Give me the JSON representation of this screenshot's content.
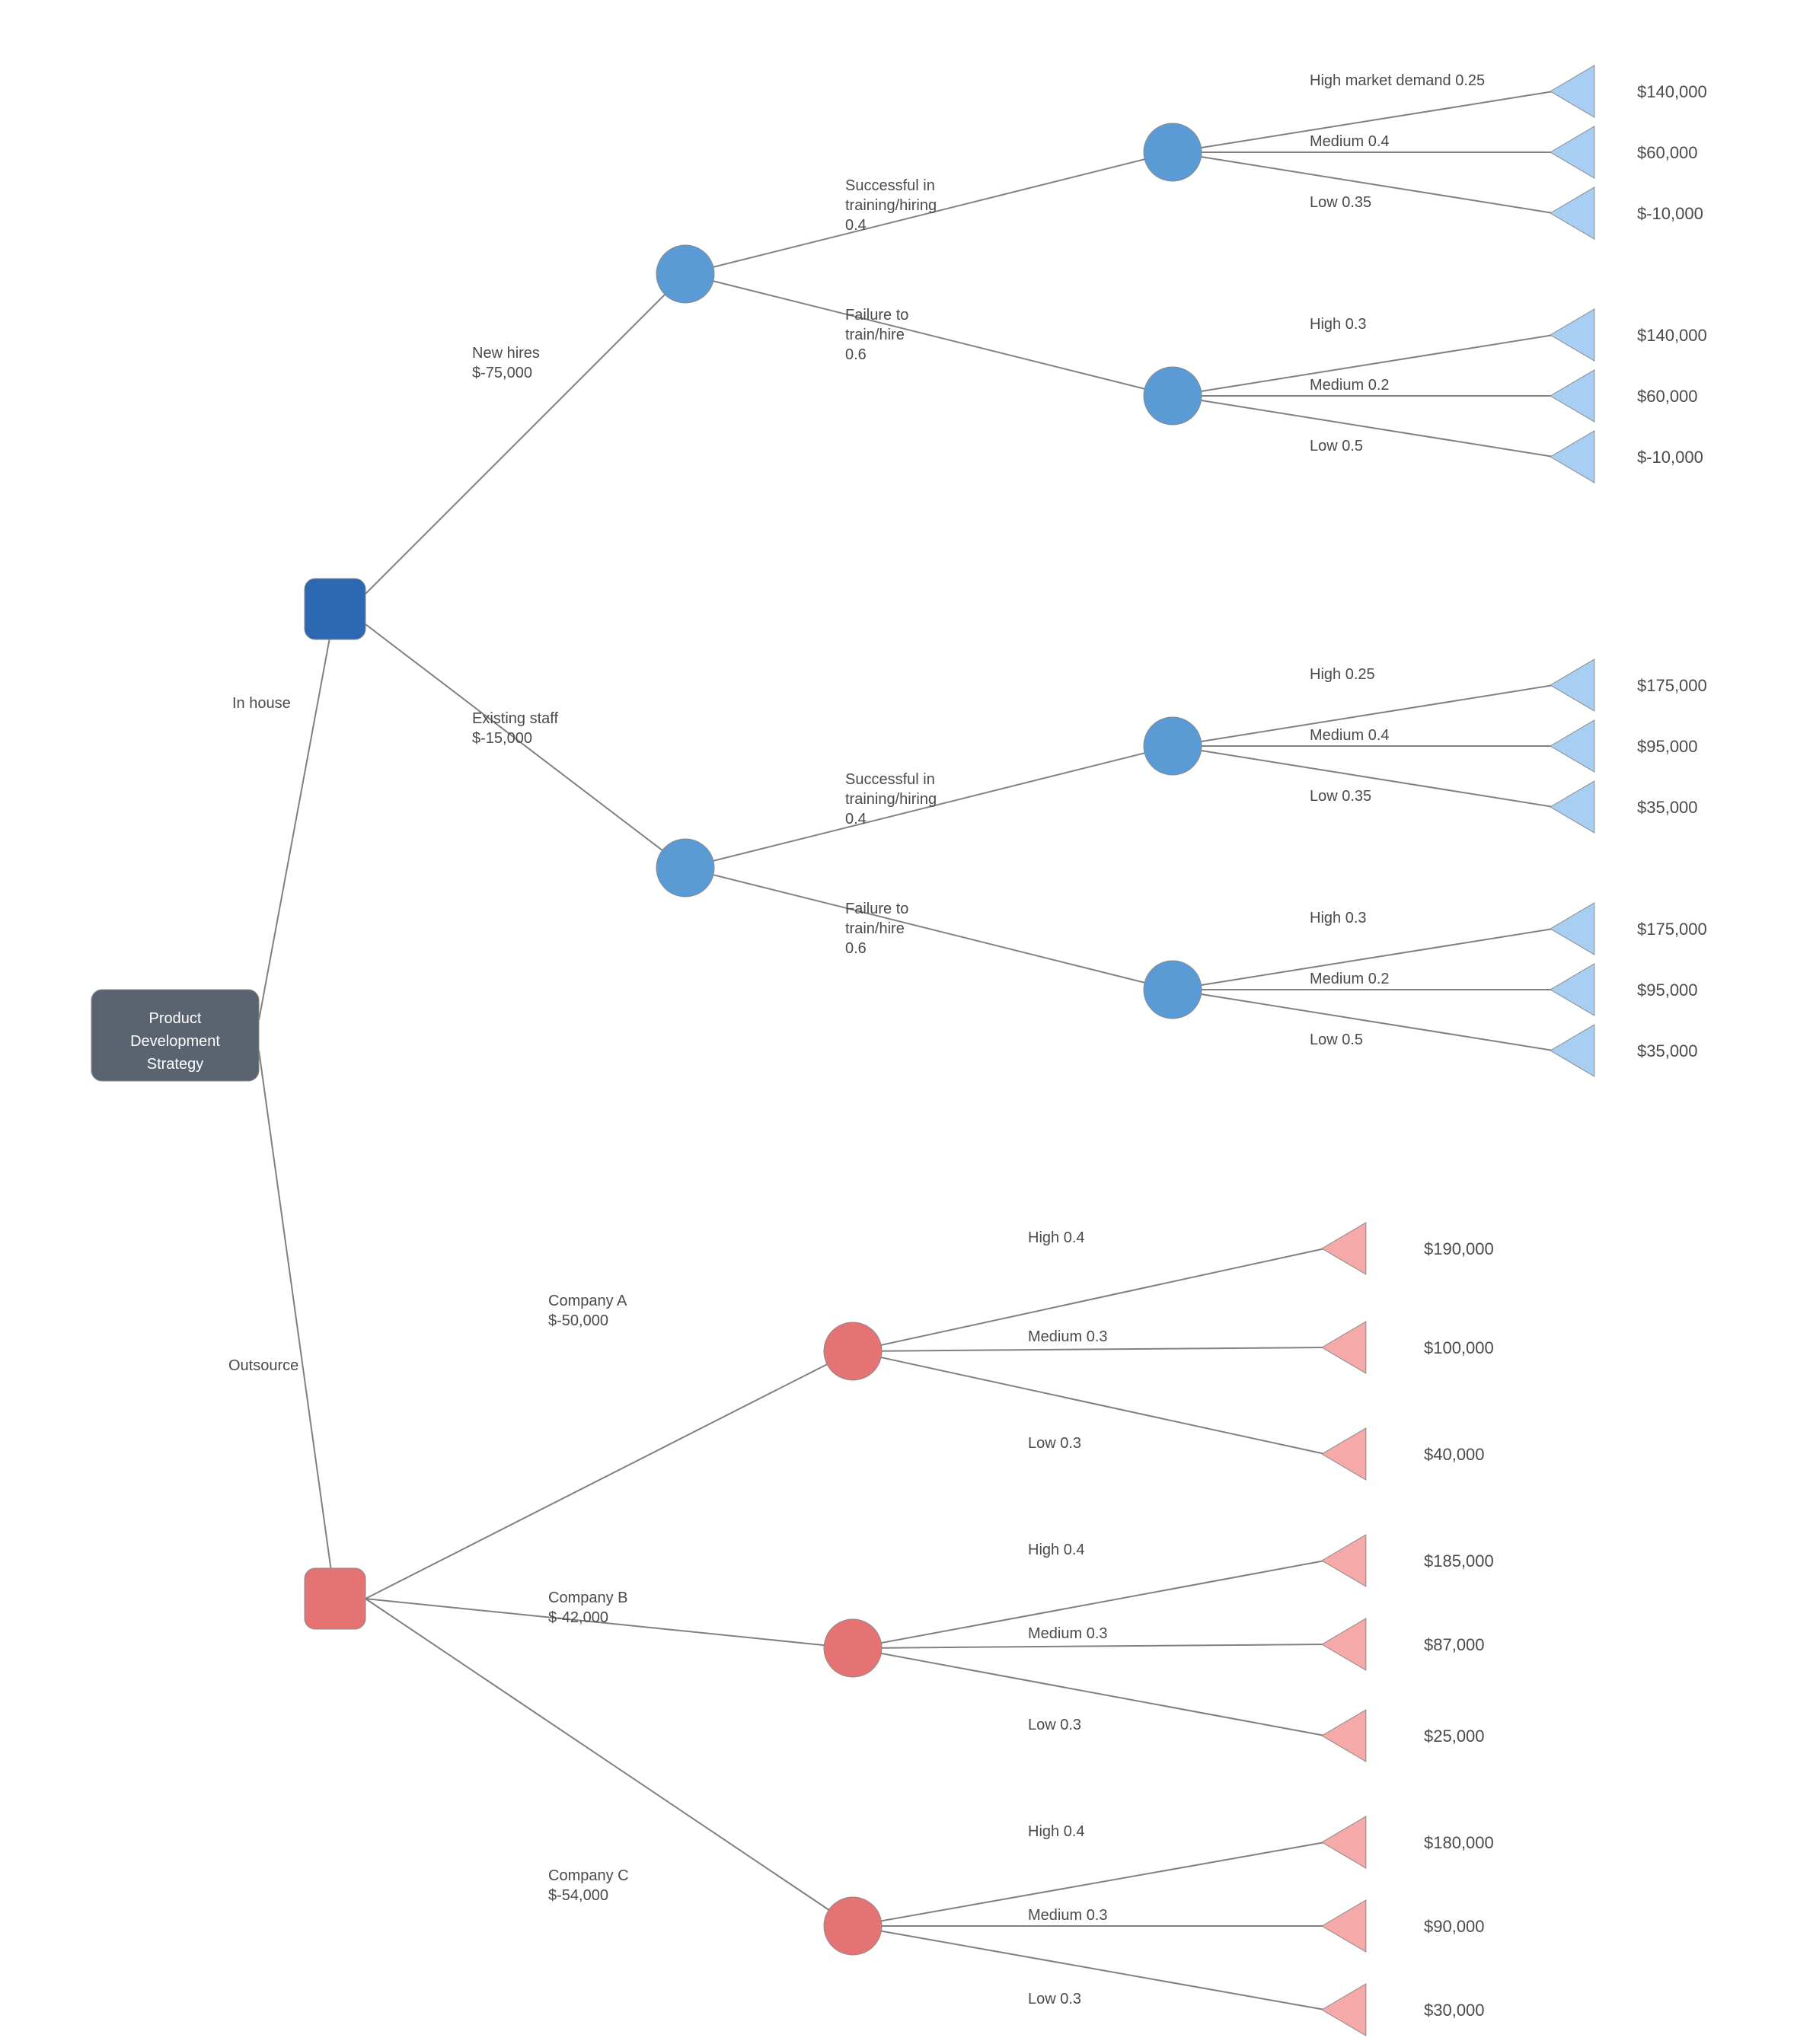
{
  "chart_data": {
    "type": "decision-tree",
    "root": {
      "label": "Product Development Strategy"
    },
    "branches": [
      {
        "name": "In house",
        "color": "blue",
        "options": [
          {
            "name": "New hires",
            "cost": "$-75,000",
            "outcomes": [
              {
                "name": "Successful in training/hiring",
                "prob": 0.4,
                "market": [
                  {
                    "name": "High market demand",
                    "prob": 0.25,
                    "value": "$140,000"
                  },
                  {
                    "name": "Medium",
                    "prob": 0.4,
                    "value": "$60,000"
                  },
                  {
                    "name": "Low",
                    "prob": 0.35,
                    "value": "$-10,000"
                  }
                ]
              },
              {
                "name": "Failure to train/hire",
                "prob": 0.6,
                "market": [
                  {
                    "name": "High",
                    "prob": 0.3,
                    "value": "$140,000"
                  },
                  {
                    "name": "Medium",
                    "prob": 0.2,
                    "value": "$60,000"
                  },
                  {
                    "name": "Low",
                    "prob": 0.5,
                    "value": "$-10,000"
                  }
                ]
              }
            ]
          },
          {
            "name": "Existing staff",
            "cost": "$-15,000",
            "outcomes": [
              {
                "name": "Successful in training/hiring",
                "prob": 0.4,
                "market": [
                  {
                    "name": "High",
                    "prob": 0.25,
                    "value": "$175,000"
                  },
                  {
                    "name": "Medium",
                    "prob": 0.4,
                    "value": "$95,000"
                  },
                  {
                    "name": "Low",
                    "prob": 0.35,
                    "value": "$35,000"
                  }
                ]
              },
              {
                "name": "Failure to train/hire",
                "prob": 0.6,
                "market": [
                  {
                    "name": "High",
                    "prob": 0.3,
                    "value": "$175,000"
                  },
                  {
                    "name": "Medium",
                    "prob": 0.2,
                    "value": "$95,000"
                  },
                  {
                    "name": "Low",
                    "prob": 0.5,
                    "value": "$35,000"
                  }
                ]
              }
            ]
          }
        ]
      },
      {
        "name": "Outsource",
        "color": "red",
        "options": [
          {
            "name": "Company A",
            "cost": "$-50,000",
            "market": [
              {
                "name": "High",
                "prob": 0.4,
                "value": "$190,000"
              },
              {
                "name": "Medium",
                "prob": 0.3,
                "value": "$100,000"
              },
              {
                "name": "Low",
                "prob": 0.3,
                "value": "$40,000"
              }
            ]
          },
          {
            "name": "Company B",
            "cost": "$-42,000",
            "market": [
              {
                "name": "High",
                "prob": 0.4,
                "value": "$185,000"
              },
              {
                "name": "Medium",
                "prob": 0.3,
                "value": "$87,000"
              },
              {
                "name": "Low",
                "prob": 0.3,
                "value": "$25,000"
              }
            ]
          },
          {
            "name": "Company C",
            "cost": "$-54,000",
            "market": [
              {
                "name": "High",
                "prob": 0.4,
                "value": "$180,000"
              },
              {
                "name": "Medium",
                "prob": 0.3,
                "value": "$90,000"
              },
              {
                "name": "Low",
                "prob": 0.3,
                "value": "$30,000"
              }
            ]
          }
        ]
      }
    ]
  },
  "colors": {
    "root_fill": "#5a6470",
    "blue_dark": "#2d68b2",
    "blue_mid": "#5b9bd5",
    "blue_light": "#a9cef4",
    "red_mid": "#e57373",
    "red_light": "#f5a9a9",
    "line": "#808080"
  }
}
